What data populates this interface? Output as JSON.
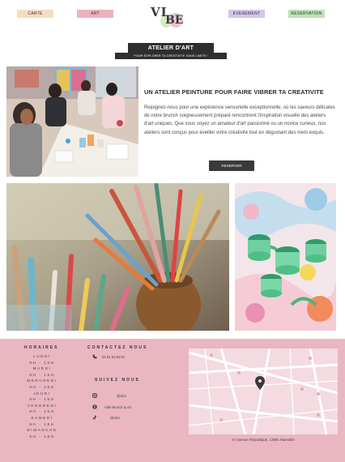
{
  "nav": {
    "items": [
      {
        "label": "CARTE",
        "color": "#f6dcc0"
      },
      {
        "label": "ART",
        "color": "#eeb1bf"
      },
      {
        "label": "EVENEMENT",
        "color": "#d6c4ea"
      },
      {
        "label": "RESERVATION",
        "color": "#bfe2b6"
      }
    ]
  },
  "logo": {
    "part1": "VI",
    "part2": "BE"
  },
  "hero": {
    "title": "ATELIER D'ART",
    "subtitle": "POUR EXPLORER TA CREATIVITE SANS LIMITE !",
    "heading": "UN ATELIER PEINTURE POUR FAIRE  VIBRER TA CREATIVITE",
    "text": "Rejoignez-nous pour une expérience sensorielle exceptionnelle, où les saveurs délicates de notre brunch soigneusement préparé rencontrent l'inspiration visuelle des ateliers d'art uniques. Que vous soyez un amateur d'art passionné ou un novice curieux, nos ateliers sont conçus pour éveiller votre créativité tout en dégustant des mets exquis.",
    "button": "RESERVER"
  },
  "footer": {
    "hours_title": "HORAIRES",
    "hours": [
      "LUNDI",
      "9H - 15H",
      "MARDI",
      "9H - 15H",
      "MERCREDI",
      "9H - 15H",
      "JEUDI",
      "9H - 15H",
      "VENDREDI",
      "9H - 15H",
      "SAMEDI",
      "9H - 18H",
      "DIMANCHE",
      "9H - 18H"
    ],
    "contact_title": "CONTACTEZ NOUS",
    "phone": "04 91 84 84 84",
    "follow_title": "SUIVEZ NOUS",
    "instagram": "@vibe",
    "facebook": "Vibe Brunch & Art",
    "tiktok": "@vibe",
    "address": "47 avenue République, 13001 Marseille"
  },
  "colors": {
    "accent": "#e9b6c1",
    "dark": "#2e2e2e"
  }
}
